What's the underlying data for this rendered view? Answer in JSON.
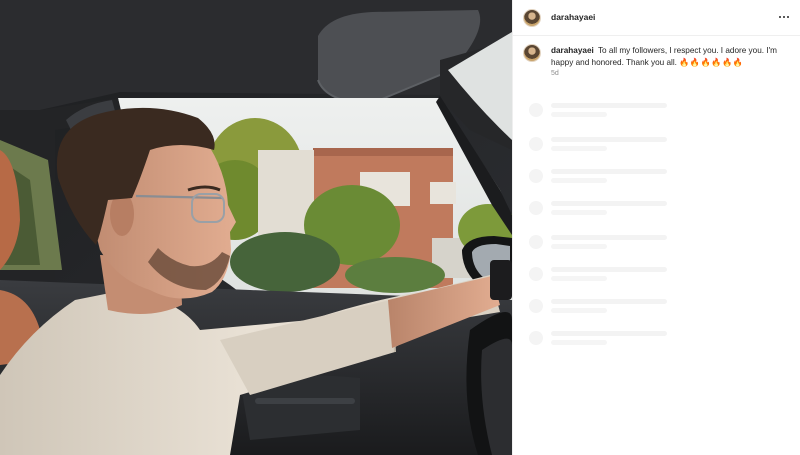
{
  "post": {
    "username": "darahayaei",
    "more_icon": "more-horizontal-icon",
    "caption": {
      "username": "darahayaei",
      "text": "To all my followers, I respect you. I adore you. I'm happy and honored. Thank you all.",
      "emojis": "🔥🔥🔥🔥🔥🔥",
      "timestamp": "5d"
    },
    "comment_placeholders": 8
  },
  "colors": {
    "text": "#262626",
    "secondary_text": "#8e8e8e",
    "divider": "#efefef",
    "skeleton": "#f3f3f3"
  }
}
